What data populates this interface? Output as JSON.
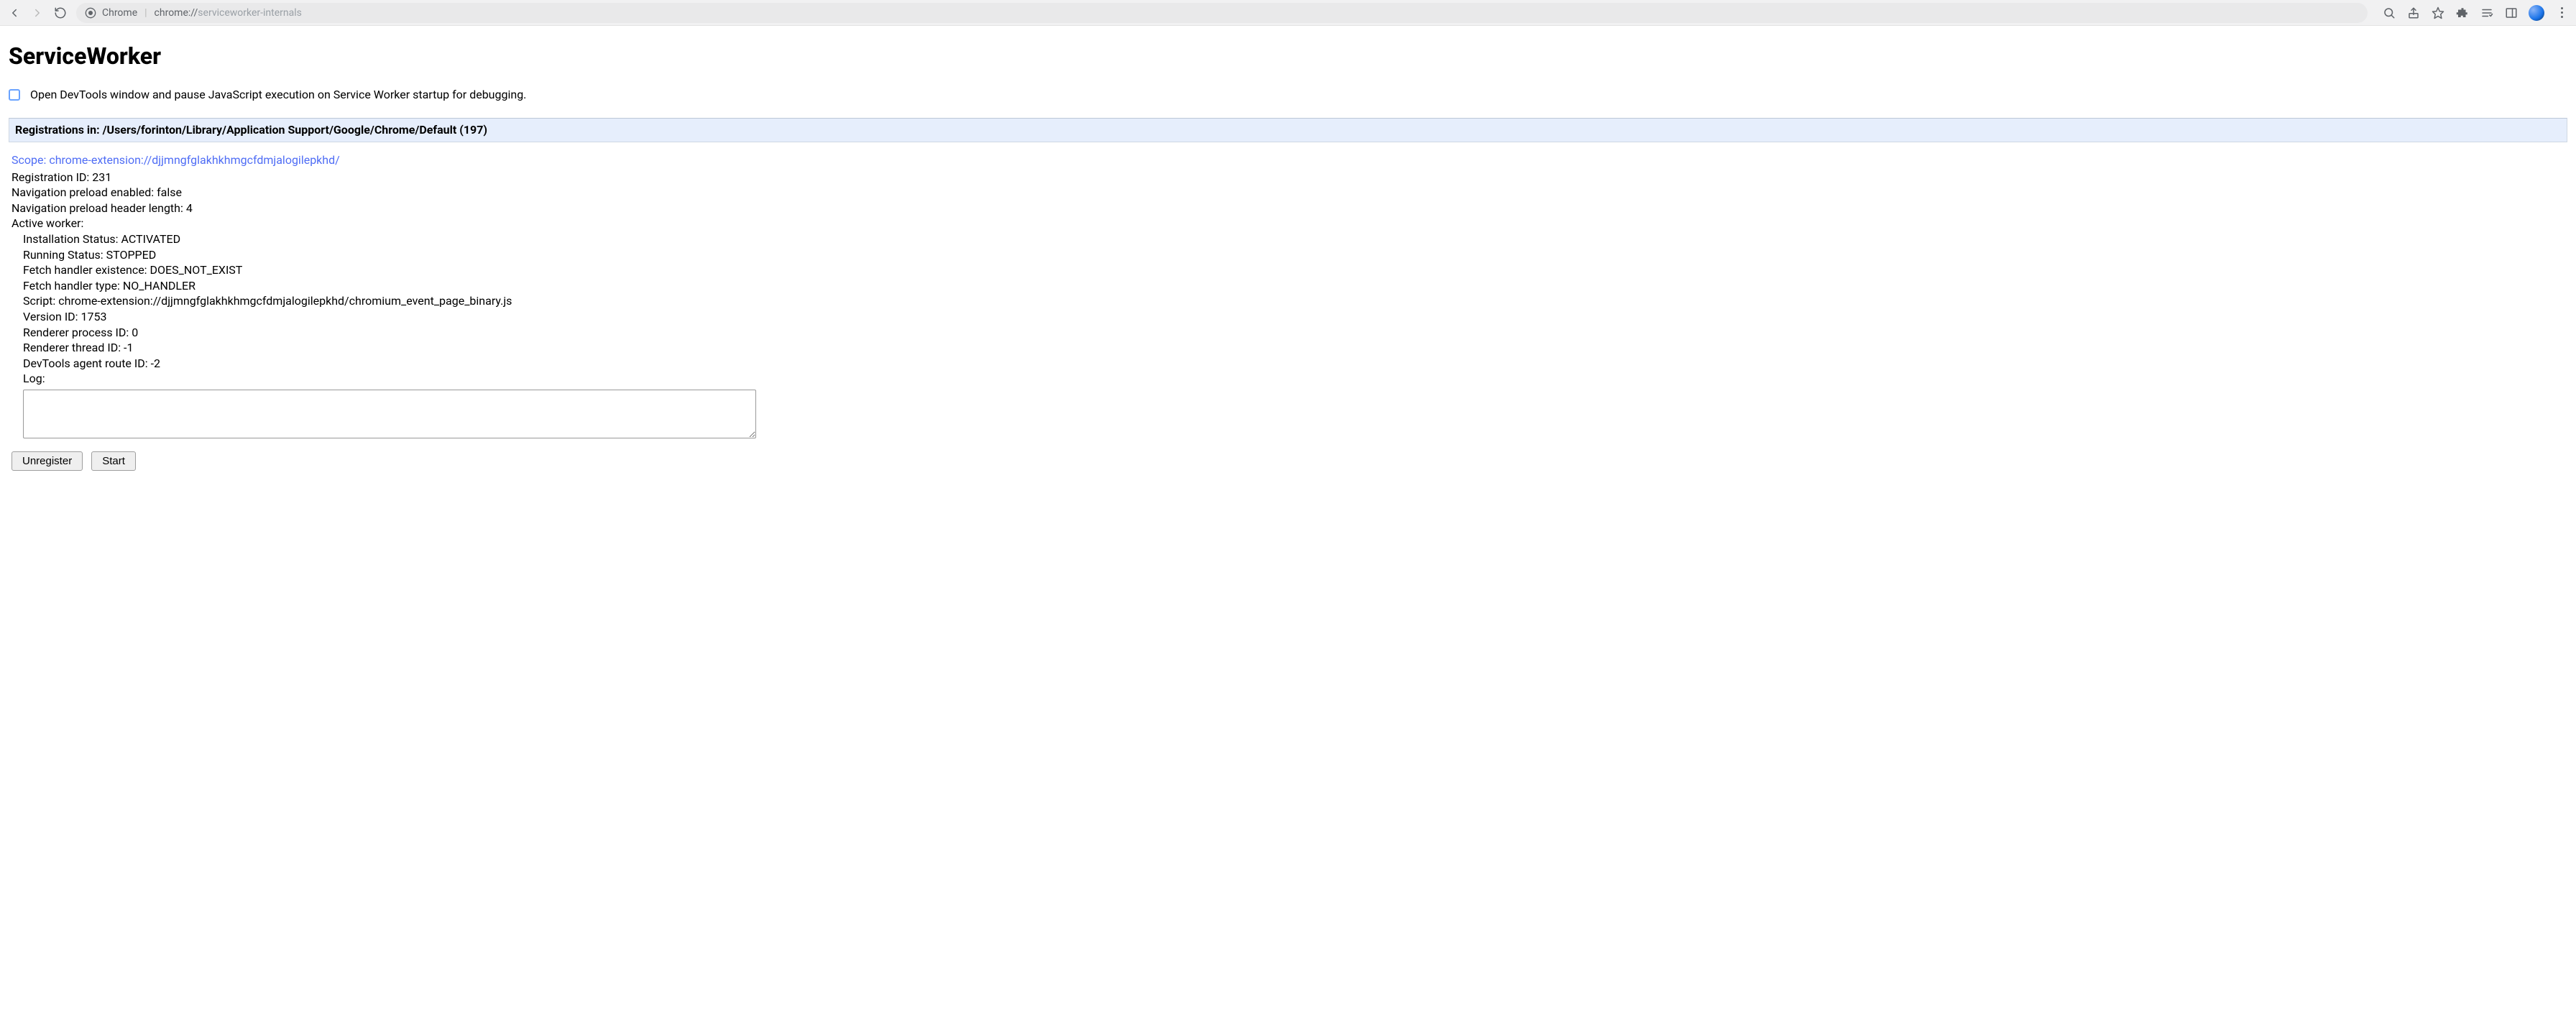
{
  "browser": {
    "url_origin_label": "Chrome",
    "url_scheme": "chrome://",
    "url_path": "serviceworker-internals"
  },
  "page": {
    "title": "ServiceWorker",
    "devtools_checkbox_label": "Open DevTools window and pause JavaScript execution on Service Worker startup for debugging.",
    "registrations_header_prefix": "Registrations in: ",
    "registrations_profile_path": "/Users/forinton/Library/Application Support/Google/Chrome/Default",
    "registrations_count": "197"
  },
  "registration": {
    "scope_label": "Scope: ",
    "scope_value": "chrome-extension://djjmngfglakhkhmgcfdmjalogilepkhd/",
    "registration_id_label": "Registration ID: ",
    "registration_id": "231",
    "nav_preload_enabled_label": "Navigation preload enabled: ",
    "nav_preload_enabled": "false",
    "nav_preload_header_len_label": "Navigation preload header length: ",
    "nav_preload_header_len": "4",
    "active_worker_label": "Active worker:",
    "installation_status_label": "Installation Status: ",
    "installation_status": "ACTIVATED",
    "running_status_label": "Running Status: ",
    "running_status": "STOPPED",
    "fetch_existence_label": "Fetch handler existence: ",
    "fetch_existence": "DOES_NOT_EXIST",
    "fetch_type_label": "Fetch handler type: ",
    "fetch_type": "NO_HANDLER",
    "script_label": "Script: ",
    "script": "chrome-extension://djjmngfglakhkhmgcfdmjalogilepkhd/chromium_event_page_binary.js",
    "version_id_label": "Version ID: ",
    "version_id": "1753",
    "renderer_pid_label": "Renderer process ID: ",
    "renderer_pid": "0",
    "renderer_tid_label": "Renderer thread ID: ",
    "renderer_tid": "-1",
    "devtools_route_label": "DevTools agent route ID: ",
    "devtools_route": "-2",
    "log_label": "Log:",
    "log_value": ""
  },
  "buttons": {
    "unregister": "Unregister",
    "start": "Start"
  }
}
